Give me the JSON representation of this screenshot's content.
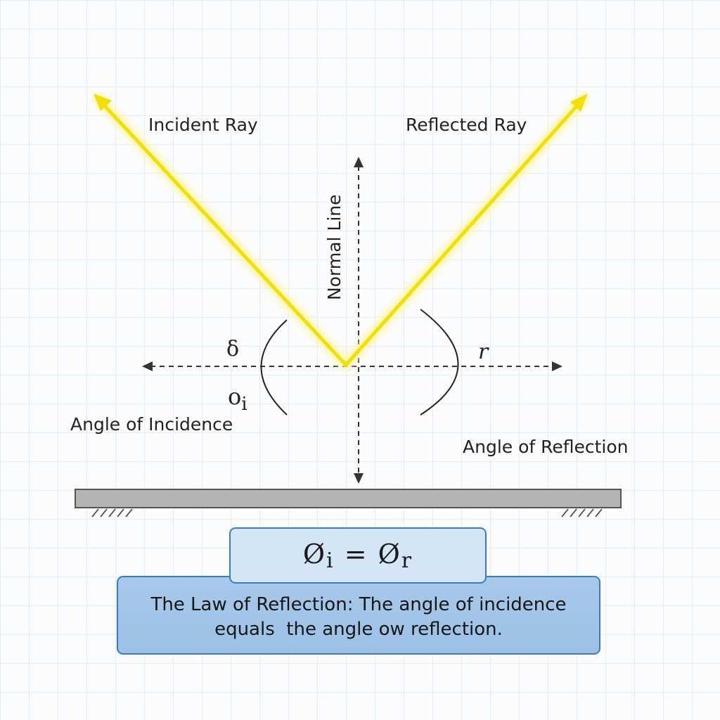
{
  "labels": {
    "incident_ray": "Incident Ray",
    "reflected_ray": "Reflected Ray",
    "normal_line": "Normal Line",
    "angle_incidence": "Angle of Incidence",
    "angle_reflection": "Angle of Reflection",
    "left_symbol_top": "δ",
    "left_symbol_bottom": "o",
    "left_symbol_sub": "i",
    "right_symbol": "r"
  },
  "formula": {
    "lhs": "Ø",
    "lhs_sub": "i",
    "equals": "=",
    "rhs": "Ø",
    "rhs_sub": "r"
  },
  "law": {
    "line1": "The Law of Reflection: The angle of incidence",
    "line2": "equals  the angle ow reflection."
  },
  "colors": {
    "ray": "#f5e400",
    "ray_glow": "#fff7a0",
    "mirror": "#b3b3b3",
    "box_border": "#3a7cc4",
    "formula_fill": "#d4e5f5",
    "law_fill": "#a7c9ea"
  }
}
